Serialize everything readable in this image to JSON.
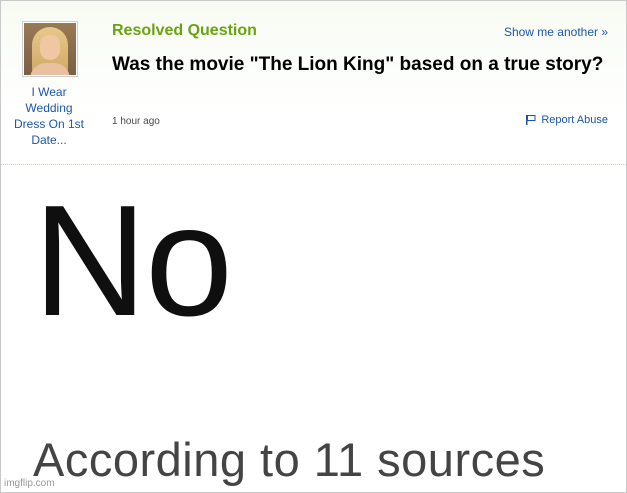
{
  "question_card": {
    "status_label": "Resolved Question",
    "show_another_label": "Show me another »",
    "question_text": "Was the movie \"The Lion King\" based on a true story?",
    "timestamp": "1 hour ago",
    "report_label": "Report Abuse",
    "user": {
      "name": "I Wear Wedding Dress On 1st Date..."
    }
  },
  "answer": {
    "main_text": "No",
    "sources_text": "According to 11 sources"
  },
  "watermark": "imgflip.com",
  "colors": {
    "status_green": "#6aa312",
    "link_blue": "#1c57a6"
  },
  "icons": {
    "report": "flag-icon"
  }
}
